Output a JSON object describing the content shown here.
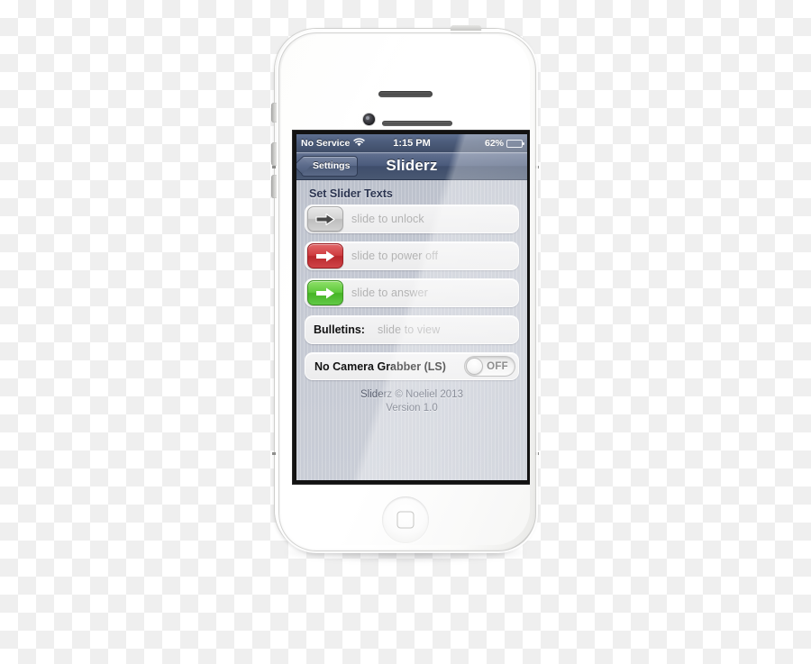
{
  "device": {
    "name": "iPhone 4S White",
    "hardware": {
      "earpiece": "earpiece-speaker",
      "front_camera": "front-camera",
      "home_button": "home-button",
      "power_button": "power-button",
      "mute_switch": "mute-switch",
      "volume_up": "volume-up-button",
      "volume_down": "volume-down-button"
    }
  },
  "status_bar": {
    "carrier": "No Service",
    "wifi_icon": "wifi-icon",
    "time": "1:15 PM",
    "battery_percent": "62%",
    "battery_level": 62,
    "battery_icon": "battery-icon"
  },
  "nav_bar": {
    "back_label": "Settings",
    "title": "Sliderz"
  },
  "section": {
    "header": "Set Slider Texts"
  },
  "slider_rows": [
    {
      "icon": "arrow-right-icon-gray",
      "color": "#c9c9c9",
      "arrow_fill": "#4a4a4a",
      "placeholder": "slide to unlock",
      "value": ""
    },
    {
      "icon": "arrow-right-icon-red",
      "color": "#cf3c40",
      "arrow_fill": "#ffffff",
      "placeholder": "slide to power off",
      "value": ""
    },
    {
      "icon": "arrow-right-icon-green",
      "color": "#5fc93c",
      "arrow_fill": "#ffffff",
      "placeholder": "slide to answer",
      "value": ""
    }
  ],
  "bulletins_row": {
    "label": "Bulletins:",
    "placeholder": "slide to view",
    "value": ""
  },
  "toggle_row": {
    "label": "No Camera Grabber (LS)",
    "state_label": "OFF",
    "on": false
  },
  "footer": {
    "line1": "Sliderz © Noeliel 2013",
    "line2": "Version 1.0"
  }
}
